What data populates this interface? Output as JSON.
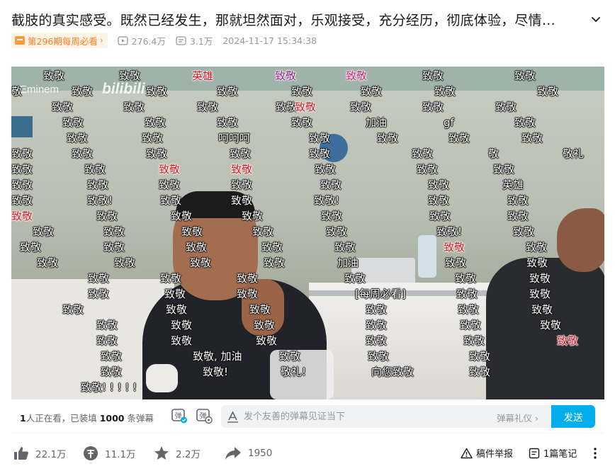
{
  "video": {
    "title": "截肢的真实感受。既然已经发生，那就坦然面对，乐观接受，充分经历，彻底体验，尽情…",
    "weekly_badge": "第296期每周必看",
    "views": "276.4万",
    "danmaku_count": "3.1万",
    "publish_time": "2024-11-17 15:34:38"
  },
  "watermark": {
    "author": "Eminem",
    "site": "bilibili"
  },
  "danmaku": [
    {
      "text": "致敬",
      "color": "white"
    },
    {
      "text": "致敬",
      "color": "white"
    },
    {
      "text": "英雄",
      "color": "red"
    },
    {
      "text": "致敬",
      "color": "purple"
    },
    {
      "text": "致敬",
      "color": "pink"
    },
    {
      "text": "致敬",
      "color": "white"
    },
    {
      "text": "致敬",
      "color": "white"
    },
    {
      "text": "敬",
      "color": "white"
    },
    {
      "text": "致敬",
      "color": "white"
    },
    {
      "text": "致敬",
      "color": "white"
    },
    {
      "text": "致敬",
      "color": "white"
    },
    {
      "text": "致敬",
      "color": "white"
    },
    {
      "text": "致敬",
      "color": "white"
    },
    {
      "text": "致敬",
      "color": "white"
    },
    {
      "text": "致敬",
      "color": "white"
    },
    {
      "text": "致敬",
      "color": "white"
    },
    {
      "text": "致敬",
      "color": "white"
    },
    {
      "text": "致敬",
      "color": "white"
    },
    {
      "text": "致敬",
      "color": "white"
    },
    {
      "text": "致敬",
      "color": "red"
    },
    {
      "text": "致敬",
      "color": "white"
    },
    {
      "text": "致敬",
      "color": "white"
    },
    {
      "text": "致敬",
      "color": "white"
    },
    {
      "text": "致敬",
      "color": "white"
    },
    {
      "text": "致敬",
      "color": "white"
    },
    {
      "text": "致敬",
      "color": "white"
    },
    {
      "text": "致敬",
      "color": "white"
    },
    {
      "text": "加油",
      "color": "white"
    },
    {
      "text": "gf",
      "color": "white"
    },
    {
      "text": "致敬",
      "color": "white"
    },
    {
      "text": "致敬",
      "color": "white"
    },
    {
      "text": "致敬",
      "color": "white"
    },
    {
      "text": "呵呵呵",
      "color": "white"
    },
    {
      "text": "致敬",
      "color": "white"
    },
    {
      "text": "致敬",
      "color": "white"
    },
    {
      "text": "致敬",
      "color": "white"
    },
    {
      "text": "致敬",
      "color": "white"
    },
    {
      "text": "致敬",
      "color": "white"
    },
    {
      "text": "致敬",
      "color": "white"
    },
    {
      "text": "致敬",
      "color": "white"
    },
    {
      "text": "致敬",
      "color": "white"
    },
    {
      "text": "致敬",
      "color": "white"
    },
    {
      "text": "致敬",
      "color": "white"
    },
    {
      "text": "敬",
      "color": "white"
    },
    {
      "text": "敬礼",
      "color": "white"
    },
    {
      "text": "致敬",
      "color": "white"
    },
    {
      "text": "致敬",
      "color": "white"
    },
    {
      "text": "致敬",
      "color": "red"
    },
    {
      "text": "致敬",
      "color": "red"
    },
    {
      "text": "致敬",
      "color": "white"
    },
    {
      "text": "致敬",
      "color": "white"
    },
    {
      "text": "致敬",
      "color": "white"
    },
    {
      "text": "致敬",
      "color": "white"
    },
    {
      "text": "致敬",
      "color": "white"
    },
    {
      "text": "致敬",
      "color": "white"
    },
    {
      "text": "致敬",
      "color": "white"
    },
    {
      "text": "致敬",
      "color": "white"
    },
    {
      "text": "致敬",
      "color": "white"
    },
    {
      "text": "英雄",
      "color": "white"
    },
    {
      "text": "致敬",
      "color": "white"
    },
    {
      "text": "致敬!",
      "color": "white"
    },
    {
      "text": "致敬",
      "color": "white"
    },
    {
      "text": "致敬",
      "color": "white"
    },
    {
      "text": "致敬!",
      "color": "white"
    },
    {
      "text": "致敬",
      "color": "white"
    },
    {
      "text": "致敬",
      "color": "white"
    },
    {
      "text": "致敬",
      "color": "red"
    },
    {
      "text": "致敬",
      "color": "white"
    },
    {
      "text": "致敬",
      "color": "white"
    },
    {
      "text": "致敬",
      "color": "white"
    },
    {
      "text": "致敬",
      "color": "white"
    },
    {
      "text": "致敬",
      "color": "white"
    },
    {
      "text": "致敬",
      "color": "white"
    },
    {
      "text": "致敬",
      "color": "white"
    },
    {
      "text": "致敬",
      "color": "white"
    },
    {
      "text": "致敬",
      "color": "white"
    },
    {
      "text": "致敬",
      "color": "white"
    },
    {
      "text": "致敬",
      "color": "white"
    },
    {
      "text": "致敬!",
      "color": "white"
    },
    {
      "text": "致敬",
      "color": "white"
    },
    {
      "text": "致敬",
      "color": "white"
    },
    {
      "text": "致敬",
      "color": "white"
    },
    {
      "text": "致敬",
      "color": "white"
    },
    {
      "text": "致敬",
      "color": "white"
    },
    {
      "text": "致敬",
      "color": "white"
    },
    {
      "text": "致敬",
      "color": "red"
    },
    {
      "text": "致敬",
      "color": "white"
    },
    {
      "text": "致敬",
      "color": "white"
    },
    {
      "text": "致敬",
      "color": "white"
    },
    {
      "text": "致敬",
      "color": "white"
    },
    {
      "text": "致敬",
      "color": "white"
    },
    {
      "text": "加油",
      "color": "white"
    },
    {
      "text": "致敬",
      "color": "white"
    },
    {
      "text": "致敬",
      "color": "white"
    },
    {
      "text": "致敬",
      "color": "white"
    },
    {
      "text": "致敬",
      "color": "white"
    },
    {
      "text": "致敬",
      "color": "white"
    },
    {
      "text": "致敬",
      "color": "white"
    },
    {
      "text": "致敬",
      "color": "white"
    },
    {
      "text": "致敬",
      "color": "white"
    },
    {
      "text": "致敬",
      "color": "white"
    },
    {
      "text": "致敬",
      "color": "white"
    },
    {
      "text": "致敬",
      "color": "white"
    },
    {
      "text": "[每周必看]",
      "color": "white"
    },
    {
      "text": "致敬",
      "color": "white"
    },
    {
      "text": "致敬",
      "color": "white"
    },
    {
      "text": "致敬",
      "color": "white"
    },
    {
      "text": "致敬",
      "color": "white"
    },
    {
      "text": "致敬",
      "color": "white"
    },
    {
      "text": "致敬",
      "color": "white"
    },
    {
      "text": "致敬",
      "color": "white"
    },
    {
      "text": "致敬",
      "color": "white"
    },
    {
      "text": "致敬",
      "color": "white"
    },
    {
      "text": "致敬",
      "color": "white"
    },
    {
      "text": "致敬",
      "color": "white"
    },
    {
      "text": "致敬",
      "color": "white"
    },
    {
      "text": "致敬",
      "color": "white"
    },
    {
      "text": "致敬",
      "color": "white"
    },
    {
      "text": "致敬",
      "color": "white"
    },
    {
      "text": "致敬",
      "color": "white"
    },
    {
      "text": "致敬",
      "color": "white"
    },
    {
      "text": "致敬",
      "color": "white"
    },
    {
      "text": "致敬",
      "color": "white"
    },
    {
      "text": "致敬",
      "color": "red"
    },
    {
      "text": "致敬",
      "color": "white"
    },
    {
      "text": "致敬, 加油",
      "color": "white"
    },
    {
      "text": "致敬",
      "color": "white"
    },
    {
      "text": "致敬",
      "color": "white"
    },
    {
      "text": "致敬",
      "color": "white"
    },
    {
      "text": "致敬",
      "color": "white"
    },
    {
      "text": "致敬!",
      "color": "white"
    },
    {
      "text": "敬礼!",
      "color": "white"
    },
    {
      "text": "向您致敬",
      "color": "white"
    },
    {
      "text": "致敬",
      "color": "white"
    },
    {
      "text": "致敬! ! ! ! !",
      "color": "white"
    }
  ],
  "send_bar": {
    "viewers_prefix": "1",
    "viewers_mid": "人正在看，已装填",
    "loaded_count": "1000",
    "viewers_suffix": "条弹幕",
    "input_placeholder": "发个友善的弹幕见证当下",
    "etiquette_label": "弹幕礼仪 ›",
    "send_label": "发送"
  },
  "toolbar": {
    "like_count": "22.1万",
    "coin_count": "11.1万",
    "fav_count": "2.2万",
    "share_count": "1950",
    "report_label": "稿件举报",
    "notes_label": "1篇笔记"
  },
  "colors": {
    "accent": "#00aeec",
    "badge_text": "#ff7f24",
    "badge_bg": "#fff3e6"
  }
}
